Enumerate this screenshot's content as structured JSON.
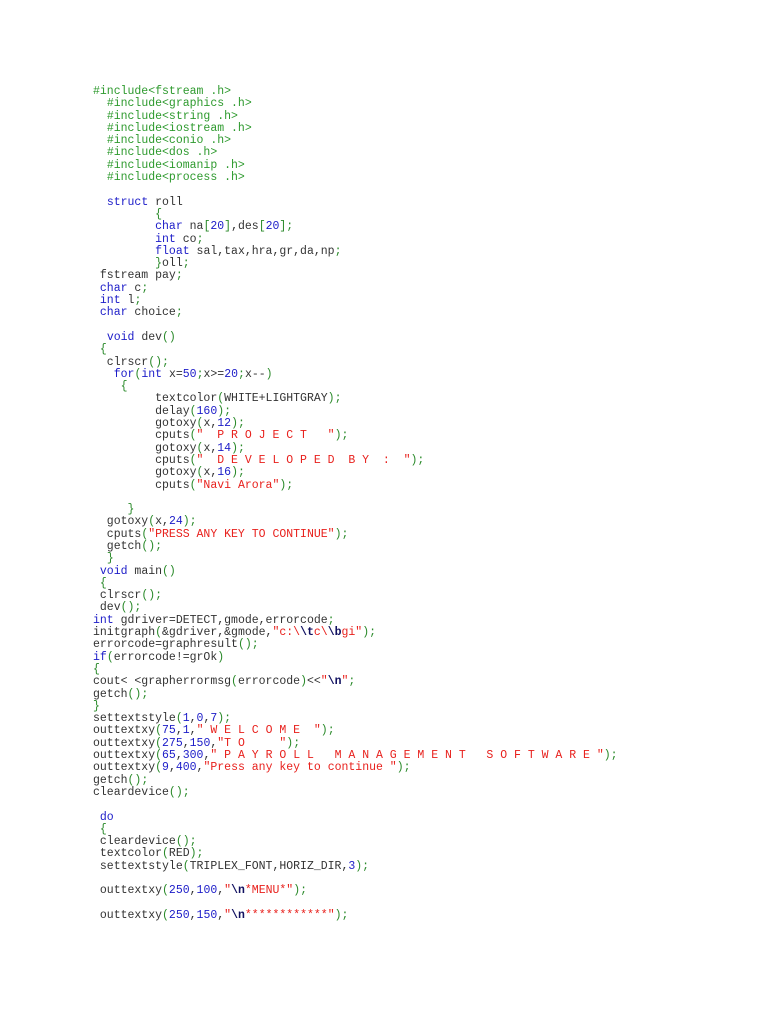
{
  "document": {
    "lines": [
      [
        [
          "i",
          "#include<fstream .h>"
        ]
      ],
      [
        [
          "",
          "  "
        ],
        [
          "i",
          "#include<graphics .h>"
        ]
      ],
      [
        [
          "",
          "  "
        ],
        [
          "i",
          "#include<string .h>"
        ]
      ],
      [
        [
          "",
          "  "
        ],
        [
          "i",
          "#include<iostream .h>"
        ]
      ],
      [
        [
          "",
          "  "
        ],
        [
          "i",
          "#include<conio .h>"
        ]
      ],
      [
        [
          "",
          "  "
        ],
        [
          "i",
          "#include<dos .h>"
        ]
      ],
      [
        [
          "",
          "  "
        ],
        [
          "i",
          "#include<iomanip .h>"
        ]
      ],
      [
        [
          "",
          "  "
        ],
        [
          "i",
          "#include<process .h>"
        ]
      ],
      [],
      [
        [
          "",
          "  "
        ],
        [
          "k",
          "struct"
        ],
        [
          "",
          " roll"
        ]
      ],
      [
        [
          "",
          "         "
        ],
        [
          "p",
          "{"
        ]
      ],
      [
        [
          "",
          "         "
        ],
        [
          "k",
          "char"
        ],
        [
          "",
          " na"
        ],
        [
          "p",
          "["
        ],
        [
          "n",
          "20"
        ],
        [
          "p",
          "]"
        ],
        [
          "",
          ",des"
        ],
        [
          "p",
          "["
        ],
        [
          "n",
          "20"
        ],
        [
          "p",
          "];"
        ]
      ],
      [
        [
          "",
          "         "
        ],
        [
          "k",
          "int"
        ],
        [
          "",
          " co"
        ],
        [
          "p",
          ";"
        ]
      ],
      [
        [
          "",
          "         "
        ],
        [
          "k",
          "float"
        ],
        [
          "",
          " sal,tax,hra,gr,da,np"
        ],
        [
          "p",
          ";"
        ]
      ],
      [
        [
          "",
          "         "
        ],
        [
          "p",
          "}"
        ],
        [
          "",
          "oll"
        ],
        [
          "p",
          ";"
        ]
      ],
      [
        [
          "",
          " fstream pay"
        ],
        [
          "p",
          ";"
        ]
      ],
      [
        [
          "",
          " "
        ],
        [
          "k",
          "char"
        ],
        [
          "",
          " c"
        ],
        [
          "p",
          ";"
        ]
      ],
      [
        [
          "",
          " "
        ],
        [
          "k",
          "int"
        ],
        [
          "",
          " l"
        ],
        [
          "p",
          ";"
        ]
      ],
      [
        [
          "",
          " "
        ],
        [
          "k",
          "char"
        ],
        [
          "",
          " choice"
        ],
        [
          "p",
          ";"
        ]
      ],
      [],
      [
        [
          "",
          "  "
        ],
        [
          "k",
          "void"
        ],
        [
          "",
          " dev"
        ],
        [
          "p",
          "()"
        ]
      ],
      [
        [
          "",
          " "
        ],
        [
          "p",
          "{"
        ]
      ],
      [
        [
          "",
          "  clrscr"
        ],
        [
          "p",
          "();"
        ]
      ],
      [
        [
          "",
          "   "
        ],
        [
          "k",
          "for"
        ],
        [
          "p",
          "("
        ],
        [
          "k",
          "int"
        ],
        [
          "",
          " x="
        ],
        [
          "n",
          "50"
        ],
        [
          "p",
          ";"
        ],
        [
          "",
          "x>="
        ],
        [
          "n",
          "20"
        ],
        [
          "p",
          ";"
        ],
        [
          "",
          "x--"
        ],
        [
          "p",
          ")"
        ]
      ],
      [
        [
          "",
          "    "
        ],
        [
          "p",
          "{"
        ]
      ],
      [
        [
          "",
          "         textcolor"
        ],
        [
          "p",
          "("
        ],
        [
          "",
          "WHITE+LIGHTGRAY"
        ],
        [
          "p",
          ");"
        ]
      ],
      [
        [
          "",
          "         delay"
        ],
        [
          "p",
          "("
        ],
        [
          "n",
          "160"
        ],
        [
          "p",
          ");"
        ]
      ],
      [
        [
          "",
          "         gotoxy"
        ],
        [
          "p",
          "("
        ],
        [
          "",
          "x,"
        ],
        [
          "n",
          "12"
        ],
        [
          "p",
          ");"
        ]
      ],
      [
        [
          "",
          "         cputs"
        ],
        [
          "p",
          "("
        ],
        [
          "s",
          "\"  P R O J E C T   \""
        ],
        [
          "p",
          ");"
        ]
      ],
      [
        [
          "",
          "         gotoxy"
        ],
        [
          "p",
          "("
        ],
        [
          "",
          "x,"
        ],
        [
          "n",
          "14"
        ],
        [
          "p",
          ");"
        ]
      ],
      [
        [
          "",
          "         cputs"
        ],
        [
          "p",
          "("
        ],
        [
          "s",
          "\"  D E V E L O P E D  B Y  :  \""
        ],
        [
          "p",
          ");"
        ]
      ],
      [
        [
          "",
          "         gotoxy"
        ],
        [
          "p",
          "("
        ],
        [
          "",
          "x,"
        ],
        [
          "n",
          "16"
        ],
        [
          "p",
          ");"
        ]
      ],
      [
        [
          "",
          "         cputs"
        ],
        [
          "p",
          "("
        ],
        [
          "s",
          "\"Navi Arora\""
        ],
        [
          "p",
          ");"
        ]
      ],
      [],
      [
        [
          "",
          "     "
        ],
        [
          "p",
          "}"
        ]
      ],
      [
        [
          "",
          "  gotoxy"
        ],
        [
          "p",
          "("
        ],
        [
          "",
          "x,"
        ],
        [
          "n",
          "24"
        ],
        [
          "p",
          ");"
        ]
      ],
      [
        [
          "",
          "  cputs"
        ],
        [
          "p",
          "("
        ],
        [
          "s",
          "\"PRESS ANY KEY TO CONTINUE\""
        ],
        [
          "p",
          ");"
        ]
      ],
      [
        [
          "",
          "  getch"
        ],
        [
          "p",
          "();"
        ]
      ],
      [
        [
          "",
          "  "
        ],
        [
          "p",
          "}"
        ]
      ],
      [
        [
          "",
          " "
        ],
        [
          "k",
          "void"
        ],
        [
          "",
          " main"
        ],
        [
          "p",
          "()"
        ]
      ],
      [
        [
          "",
          " "
        ],
        [
          "p",
          "{"
        ]
      ],
      [
        [
          "",
          " clrscr"
        ],
        [
          "p",
          "();"
        ]
      ],
      [
        [
          "",
          " dev"
        ],
        [
          "p",
          "();"
        ]
      ],
      [
        [
          "k",
          "int"
        ],
        [
          "",
          " gdriver=DETECT,gmode,errorcode"
        ],
        [
          "p",
          ";"
        ]
      ],
      [
        [
          "",
          "initgraph"
        ],
        [
          "p",
          "("
        ],
        [
          "",
          "&gdriver,&gmode,"
        ],
        [
          "s",
          "\"c:\\"
        ],
        [
          "e",
          "\\t"
        ],
        [
          "s",
          "c\\"
        ],
        [
          "e",
          "\\b"
        ],
        [
          "s",
          "gi\""
        ],
        [
          "p",
          ");"
        ]
      ],
      [
        [
          "",
          "errorcode=graphresult"
        ],
        [
          "p",
          "();"
        ]
      ],
      [
        [
          "k",
          "if"
        ],
        [
          "p",
          "("
        ],
        [
          "",
          "errorcode!=grOk"
        ],
        [
          "p",
          ")"
        ]
      ],
      [
        [
          "p",
          "{"
        ]
      ],
      [
        [
          "",
          "cout< <grapherrormsg"
        ],
        [
          "p",
          "("
        ],
        [
          "",
          "errorcode"
        ],
        [
          "p",
          ")"
        ],
        [
          "",
          "<<"
        ],
        [
          "s",
          "\""
        ],
        [
          "e",
          "\\n"
        ],
        [
          "s",
          "\""
        ],
        [
          "p",
          ";"
        ]
      ],
      [
        [
          "",
          "getch"
        ],
        [
          "p",
          "();"
        ]
      ],
      [
        [
          "p",
          "}"
        ]
      ],
      [
        [
          "",
          "settextstyle"
        ],
        [
          "p",
          "("
        ],
        [
          "n",
          "1"
        ],
        [
          "",
          ","
        ],
        [
          "n",
          "0"
        ],
        [
          "",
          ","
        ],
        [
          "n",
          "7"
        ],
        [
          "p",
          ");"
        ]
      ],
      [
        [
          "",
          "outtextxy"
        ],
        [
          "p",
          "("
        ],
        [
          "n",
          "75"
        ],
        [
          "",
          ","
        ],
        [
          "n",
          "1"
        ],
        [
          "",
          ","
        ],
        [
          "s",
          "\" W E L C O M E  \""
        ],
        [
          "p",
          ");"
        ]
      ],
      [
        [
          "",
          "outtextxy"
        ],
        [
          "p",
          "("
        ],
        [
          "n",
          "275"
        ],
        [
          "",
          ","
        ],
        [
          "n",
          "150"
        ],
        [
          "",
          ","
        ],
        [
          "s",
          "\"T O     \""
        ],
        [
          "p",
          ");"
        ]
      ],
      [
        [
          "",
          "outtextxy"
        ],
        [
          "p",
          "("
        ],
        [
          "n",
          "65"
        ],
        [
          "",
          ","
        ],
        [
          "n",
          "300"
        ],
        [
          "",
          ","
        ],
        [
          "s",
          "\" P A Y R O L L   M A N A G E M E N T   S O F T W A R E \""
        ],
        [
          "p",
          ");"
        ]
      ],
      [
        [
          "",
          "outtextxy"
        ],
        [
          "p",
          "("
        ],
        [
          "n",
          "9"
        ],
        [
          "",
          ","
        ],
        [
          "n",
          "400"
        ],
        [
          "",
          ","
        ],
        [
          "s",
          "\"Press any key to continue \""
        ],
        [
          "p",
          ");"
        ]
      ],
      [
        [
          "",
          "getch"
        ],
        [
          "p",
          "();"
        ]
      ],
      [
        [
          "",
          "cleardevice"
        ],
        [
          "p",
          "();"
        ]
      ],
      [],
      [
        [
          "",
          " "
        ],
        [
          "k",
          "do"
        ]
      ],
      [
        [
          "",
          " "
        ],
        [
          "p",
          "{"
        ]
      ],
      [
        [
          "",
          " cleardevice"
        ],
        [
          "p",
          "();"
        ]
      ],
      [
        [
          "",
          " textcolor"
        ],
        [
          "p",
          "("
        ],
        [
          "",
          "RED"
        ],
        [
          "p",
          ");"
        ]
      ],
      [
        [
          "",
          " settextstyle"
        ],
        [
          "p",
          "("
        ],
        [
          "",
          "TRIPLEX_FONT,HORIZ_DIR,"
        ],
        [
          "n",
          "3"
        ],
        [
          "p",
          ");"
        ]
      ],
      [],
      [
        [
          "",
          " outtextxy"
        ],
        [
          "p",
          "("
        ],
        [
          "n",
          "250"
        ],
        [
          "",
          ","
        ],
        [
          "n",
          "100"
        ],
        [
          "",
          ","
        ],
        [
          "s",
          "\""
        ],
        [
          "e",
          "\\n"
        ],
        [
          "s",
          "*MENU*\""
        ],
        [
          "p",
          ");"
        ]
      ],
      [],
      [
        [
          "",
          " outtextxy"
        ],
        [
          "p",
          "("
        ],
        [
          "n",
          "250"
        ],
        [
          "",
          ","
        ],
        [
          "n",
          "150"
        ],
        [
          "",
          ","
        ],
        [
          "s",
          "\""
        ],
        [
          "e",
          "\\n"
        ],
        [
          "s",
          "************\""
        ],
        [
          "p",
          ");"
        ]
      ]
    ]
  }
}
